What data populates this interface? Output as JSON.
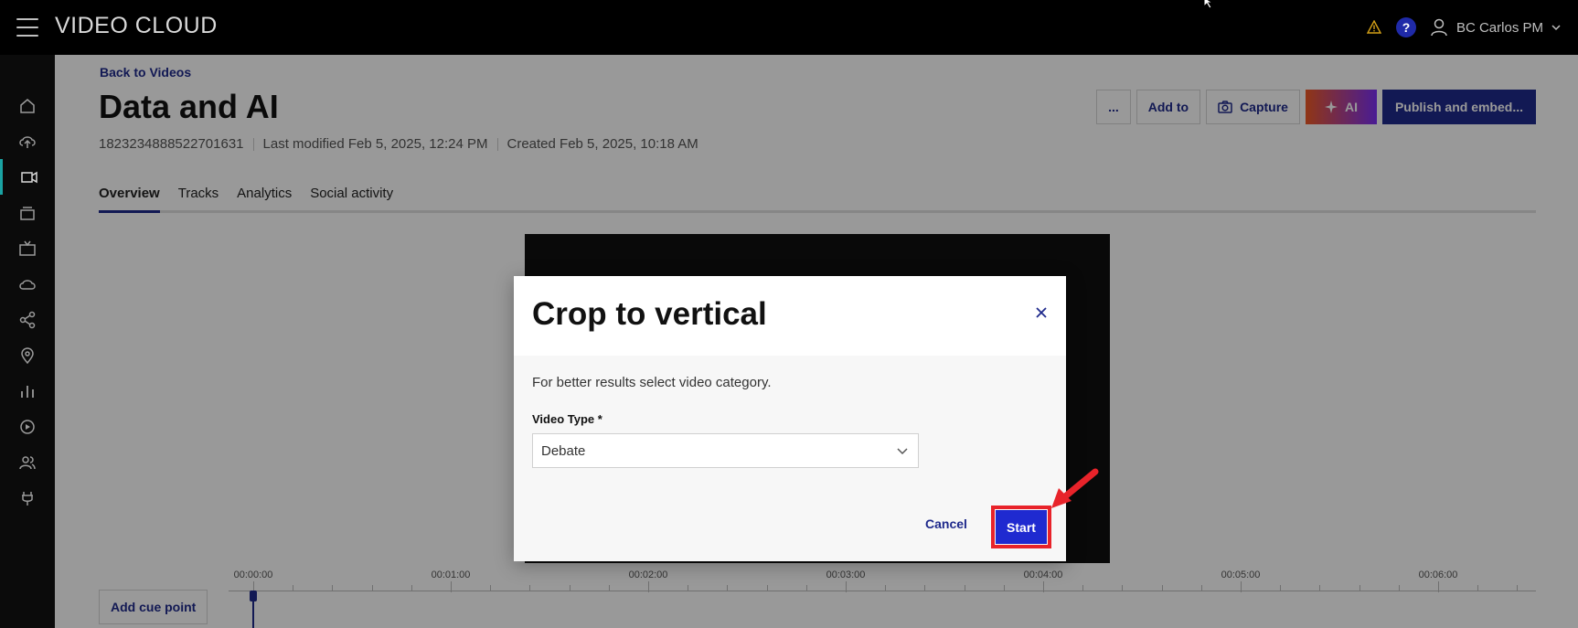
{
  "topbar": {
    "logo": "VIDEO CLOUD",
    "user_name": "BC Carlos PM",
    "help_label": "?",
    "icons": [
      "menu-icon",
      "warning-icon",
      "help-icon",
      "user-icon",
      "chevron-down-icon"
    ]
  },
  "sidebar": {
    "items": [
      {
        "icon": "home-icon"
      },
      {
        "icon": "upload-icon"
      },
      {
        "icon": "video-icon",
        "active": true
      },
      {
        "icon": "playlist-icon"
      },
      {
        "icon": "tv-icon"
      },
      {
        "icon": "cloud-icon"
      },
      {
        "icon": "share-icon"
      },
      {
        "icon": "location-icon"
      },
      {
        "icon": "analytics-icon"
      },
      {
        "icon": "player-icon"
      },
      {
        "icon": "users-icon"
      },
      {
        "icon": "plugin-icon"
      }
    ]
  },
  "page": {
    "back_link": "Back to Videos",
    "title": "Data and AI",
    "video_id": "1823234888522701631",
    "last_modified": "Last modified Feb 5, 2025, 12:24 PM",
    "created": "Created Feb 5, 2025, 10:18 AM",
    "actions": {
      "more": "...",
      "add_to": "Add to",
      "capture": "Capture",
      "ai": "AI",
      "publish": "Publish and embed..."
    },
    "tabs": [
      "Overview",
      "Tracks",
      "Analytics",
      "Social activity"
    ],
    "active_tab": "Overview"
  },
  "timeline": {
    "add_cue_point": "Add cue point",
    "labels": [
      "00:00:00",
      "00:01:00",
      "00:02:00",
      "00:03:00",
      "00:04:00",
      "00:05:00",
      "00:06:00"
    ]
  },
  "modal": {
    "title": "Crop to vertical",
    "description": "For better results select video category.",
    "field_label": "Video Type *",
    "selected_value": "Debate",
    "cancel_label": "Cancel",
    "start_label": "Start"
  },
  "colors": {
    "brand_blue": "#1f2a8c",
    "start_blue": "#1f2ad0",
    "highlight_red": "#e8232a",
    "active_teal": "#1aa3a3"
  }
}
